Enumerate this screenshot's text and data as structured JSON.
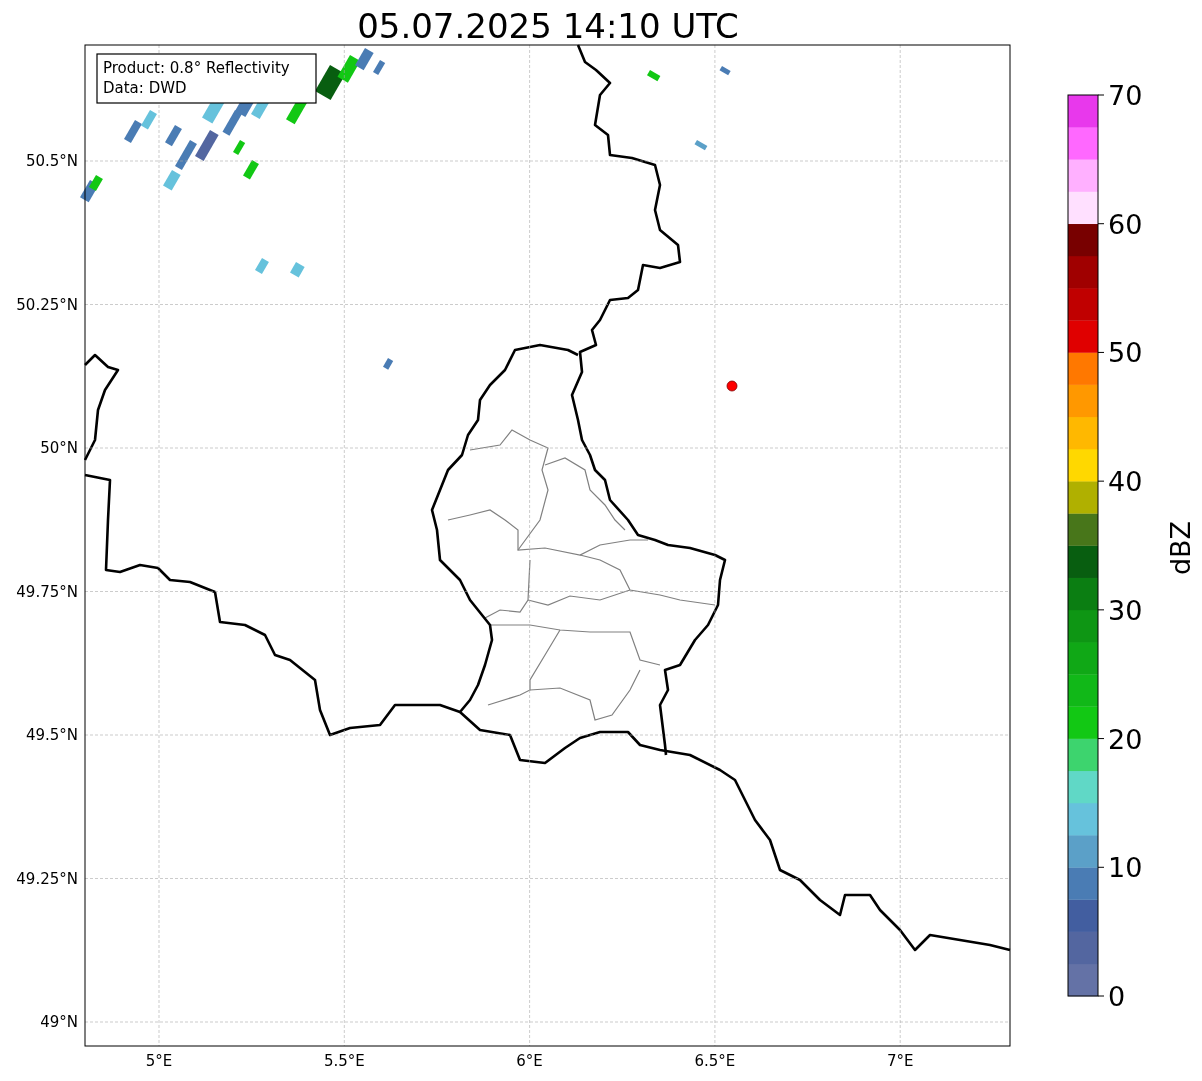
{
  "title": "05.07.2025 14:10 UTC",
  "info_box": {
    "lines": [
      "Product: 0.8° Reflectivity",
      "Data: DWD"
    ]
  },
  "map": {
    "x_ticks": [
      "5°E",
      "5.5°E",
      "6°E",
      "6.5°E",
      "7°E"
    ],
    "y_ticks": [
      "50.5°N",
      "50.25°N",
      "50°N",
      "49.75°N",
      "49.5°N",
      "49.25°N",
      "49°N"
    ],
    "marker": {
      "color": "#ff0000"
    }
  },
  "colorbar": {
    "label": "dBZ",
    "ticks": [
      "70",
      "60",
      "50",
      "40",
      "30",
      "20",
      "10",
      "0"
    ],
    "segments": [
      {
        "color": "#6472a6"
      },
      {
        "color": "#5366a0"
      },
      {
        "color": "#425ea0"
      },
      {
        "color": "#4a7cb4"
      },
      {
        "color": "#5ba0c8"
      },
      {
        "color": "#66c2dc"
      },
      {
        "color": "#60d8c6"
      },
      {
        "color": "#3dd46e"
      },
      {
        "color": "#12c814"
      },
      {
        "color": "#11b818"
      },
      {
        "color": "#10a816"
      },
      {
        "color": "#0e9614"
      },
      {
        "color": "#0b7e12"
      },
      {
        "color": "#085e10"
      },
      {
        "color": "#48761a"
      },
      {
        "color": "#b0b000"
      },
      {
        "color": "#ffd800"
      },
      {
        "color": "#ffb800"
      },
      {
        "color": "#ff9800"
      },
      {
        "color": "#ff7800"
      },
      {
        "color": "#e00000"
      },
      {
        "color": "#c00000"
      },
      {
        "color": "#a00000"
      },
      {
        "color": "#780000"
      },
      {
        "color": "#ffe0ff"
      },
      {
        "color": "#ffb0ff"
      },
      {
        "color": "#ff68ff"
      },
      {
        "color": "#e838ec"
      }
    ]
  }
}
